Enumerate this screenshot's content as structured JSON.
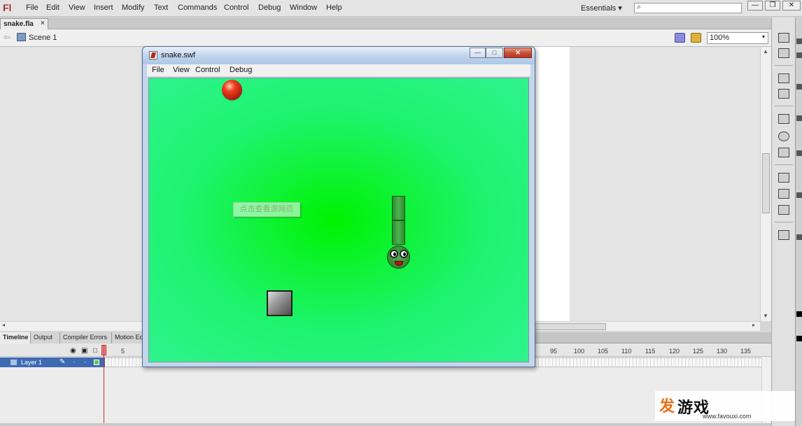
{
  "app": {
    "logo": "Fl",
    "menus": [
      "File",
      "Edit",
      "View",
      "Insert",
      "Modify",
      "Text",
      "Commands",
      "Control",
      "Debug",
      "Window",
      "Help"
    ],
    "workspace": "Essentials",
    "workspace_arrow": "▾",
    "window_controls": [
      "—",
      "❐",
      "✕"
    ]
  },
  "document": {
    "tab": "snake.fla",
    "tab_close": "×",
    "scene": "Scene 1",
    "zoom": "100%",
    "zoom_arrow": "▾"
  },
  "timeline": {
    "tabs": [
      "Timeline",
      "Output",
      "Compiler Errors",
      "Motion Ed"
    ],
    "layer_name": "Layer 1",
    "frame_numbers": [
      "5",
      "95",
      "100",
      "105",
      "110",
      "115",
      "120",
      "125",
      "130",
      "135"
    ],
    "current_frame": "1"
  },
  "swf_window": {
    "title": "snake.swf",
    "menus": [
      "File",
      "View",
      "Control",
      "Debug"
    ],
    "minimize": "—",
    "maximize": "□",
    "close": "✕"
  },
  "game": {
    "tooltip": "点击查看源网页"
  },
  "watermark": {
    "logo": "发",
    "name": "游戏",
    "url": "www.favouxi.com"
  },
  "colors": {
    "stage_green": "#00f200",
    "food_red": "#f04020",
    "snake_green": "#2b8b2b",
    "selected_layer": "#3e6ab2"
  }
}
